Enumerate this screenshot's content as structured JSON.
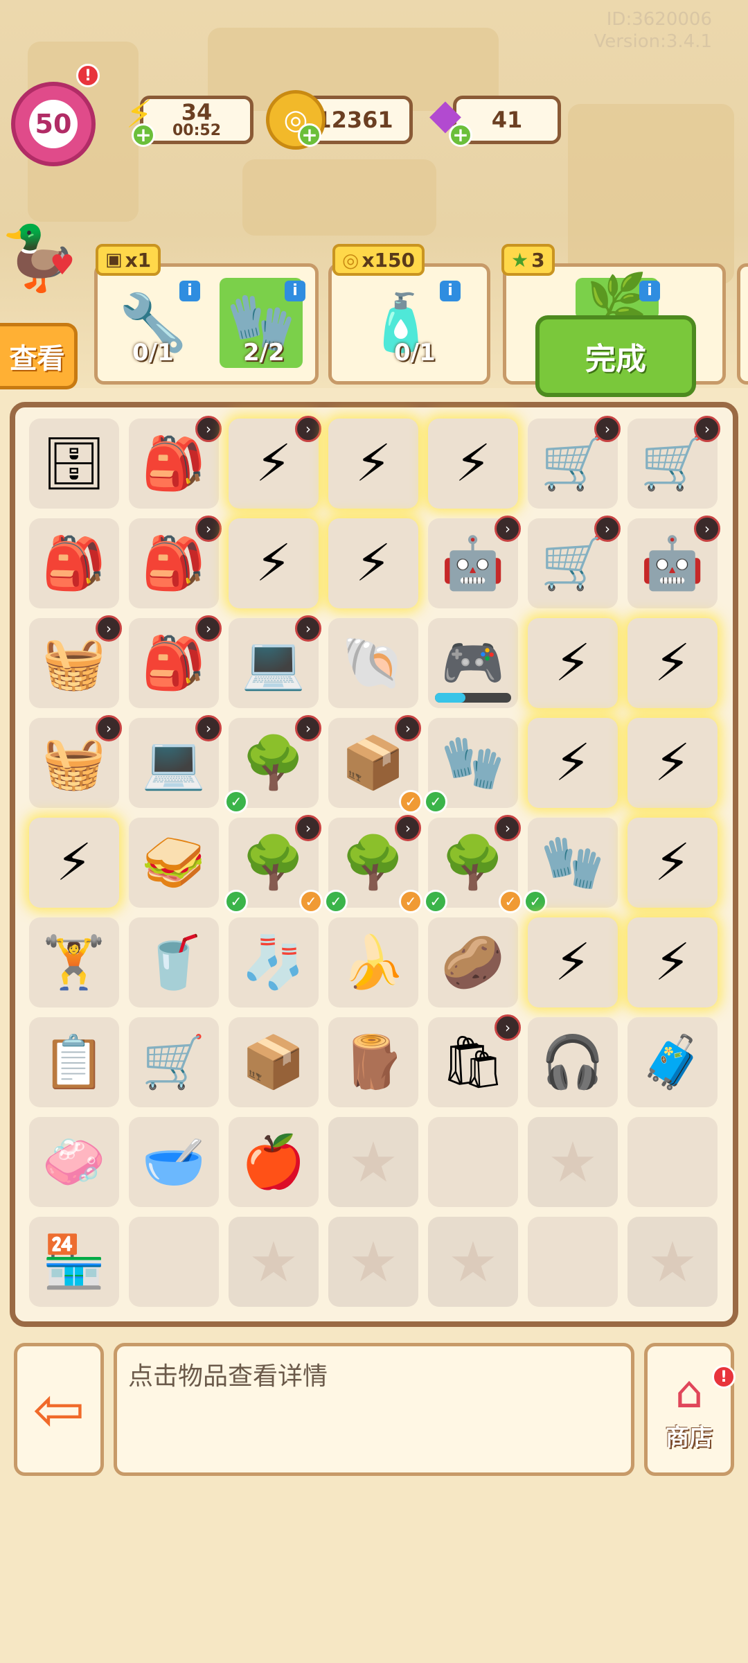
{
  "meta": {
    "id": "ID:3620006",
    "version": "Version:3.4.1"
  },
  "player": {
    "level": "50",
    "alert": "!"
  },
  "resources": {
    "energy": {
      "value": "34",
      "timer": "00:52",
      "icon": "lightning-icon"
    },
    "coins": {
      "value": "12361",
      "icon": "coin-icon"
    },
    "gems": {
      "value": "41",
      "icon": "gem-icon"
    }
  },
  "quests": {
    "look_button": "查看",
    "complete_button": "完成",
    "items": [
      {
        "reward": "x1",
        "slots": [
          {
            "icon": "drill-saw",
            "progress": "0/1"
          },
          {
            "icon": "glove",
            "progress": "2/2"
          }
        ]
      },
      {
        "reward": "x150",
        "slots": [
          {
            "icon": "shaker-bottle",
            "progress": "0/1"
          }
        ]
      },
      {
        "reward": "3",
        "slots": [
          {
            "icon": "plant",
            "progress": ""
          }
        ]
      }
    ]
  },
  "info_text": "点击物品查看详情",
  "shop_label": "商店",
  "colors": {
    "accent": "#7ac83b",
    "board_border": "#9a6a44",
    "level": "#e04b8a"
  },
  "board": [
    [
      "🗄",
      "🎒",
      "⚡",
      "⚡",
      "⚡",
      "🛒",
      "🛒"
    ],
    [
      "🎒",
      "🎒",
      "⚡",
      "⚡",
      "🤖",
      "🛒",
      "🤖"
    ],
    [
      "🧺",
      "🎒",
      "💻",
      "🐚",
      "🎮",
      "⚡",
      "⚡"
    ],
    [
      "🧺",
      "💻",
      "🌳",
      "📦",
      "🧤",
      "⚡",
      "⚡"
    ],
    [
      "⚡",
      "🥪",
      "🌳",
      "🌳",
      "🌳",
      "🧤",
      "⚡"
    ],
    [
      "🏋",
      "🥤",
      "🧦",
      "🍌",
      "🥔",
      "⚡",
      "⚡"
    ],
    [
      "📋",
      "🛒",
      "📦",
      "🪵",
      "🛍",
      "🎧",
      "🧳"
    ],
    [
      "🧼",
      "🥣",
      "🍎",
      "☆",
      "",
      "☆",
      ""
    ],
    [
      "🏪",
      "",
      "☆",
      "☆",
      "☆",
      "",
      "☆"
    ]
  ]
}
